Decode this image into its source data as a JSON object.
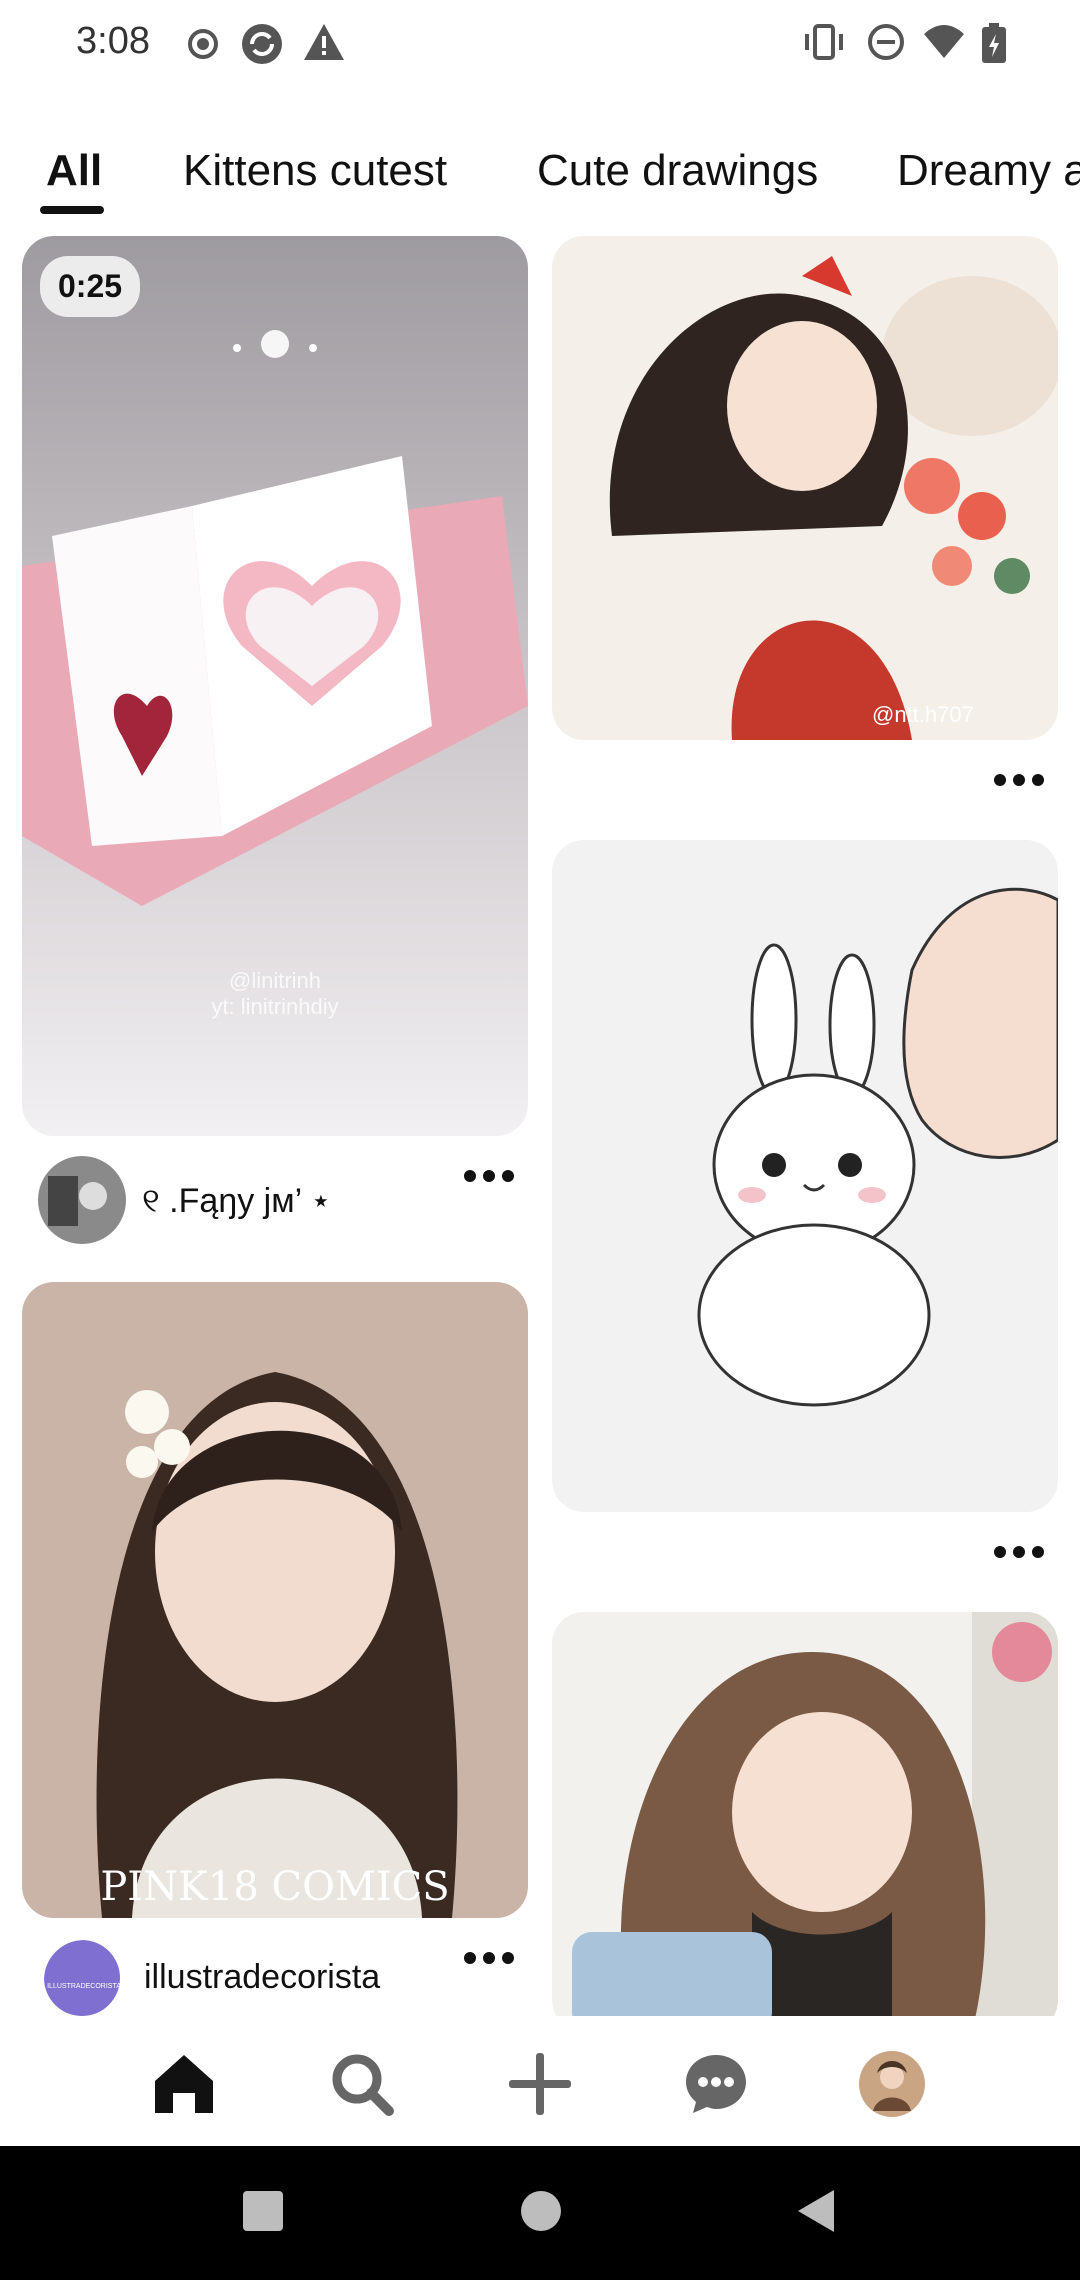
{
  "status_bar": {
    "time": "3:08"
  },
  "tabs": [
    {
      "label": "All",
      "selected": true
    },
    {
      "label": "Kittens cutest",
      "selected": false
    },
    {
      "label": "Cute drawings",
      "selected": false
    },
    {
      "label": "Dreamy a",
      "selected": false
    }
  ],
  "pins": {
    "video_card": {
      "duration": "0:25",
      "watermark_1": "@linitrinh",
      "watermark_2": "yt: linitrinhdiy",
      "user_name": "୧ .Fąŋy jм’ ⋆"
    },
    "girl_roses": {
      "watermark": "@ntt.h707"
    },
    "bunny": {},
    "girl_flower": {
      "watermark": "PINK18 COMICS",
      "user_name": "illustradecorista",
      "avatar_text": "ILLUSTRADECORISTA"
    },
    "laughing_girl": {}
  },
  "colors": {
    "accent": "#111111",
    "background": "#ffffff",
    "system_nav": "#000000"
  }
}
